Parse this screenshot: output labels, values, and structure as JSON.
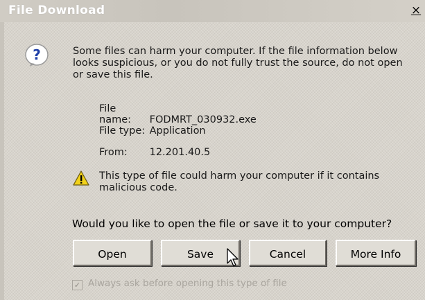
{
  "window": {
    "title": "File Download",
    "close_glyph": "×"
  },
  "message": {
    "icon": "question-icon",
    "text": "Some files can harm your computer. If the file information below looks suspicious, or you do not fully trust the source, do not open or save this file."
  },
  "file_info": {
    "name_label": "File name:",
    "name_value": "FODMRT_030932.exe",
    "type_label": "File type:",
    "type_value": "Application",
    "from_label": "From:",
    "from_value": "12.201.40.5"
  },
  "warning": {
    "icon": "warning-icon",
    "text": "This type of file could harm your computer if it contains malicious code."
  },
  "prompt": {
    "text": "Would you like to open the file or save it to your computer?"
  },
  "buttons": {
    "open": "Open",
    "save": "Save",
    "cancel": "Cancel",
    "more_info": "More Info"
  },
  "checkbox": {
    "label": "Always ask before opening this type of file",
    "checked": true,
    "check_glyph": "✓",
    "enabled": false
  },
  "colors": {
    "dialog_bg": "#d8d4cc",
    "title_text": "#ffffff",
    "icon_blue": "#1f3fa8",
    "warning_yellow": "#f2d21a",
    "disabled_text": "#a9a59e"
  }
}
